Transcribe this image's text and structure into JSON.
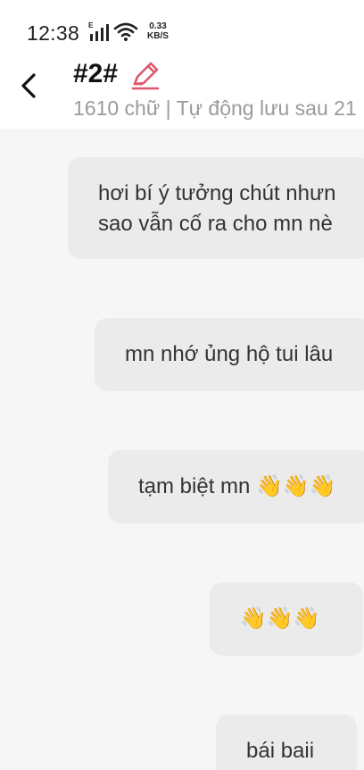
{
  "status_bar": {
    "time": "12:38",
    "network_type": "E",
    "speed_value": "0.33",
    "speed_unit": "KB/S",
    "icons": [
      "signal-icon",
      "wifi-icon"
    ]
  },
  "header": {
    "title": "#2#",
    "meta": "1610 chữ | Tự động lưu sau 21",
    "icons": [
      "back-arrow-icon",
      "pencil-edit-icon"
    ],
    "edit_icon_color": "#e0566b"
  },
  "messages": [
    {
      "lines": [
        "hơi bí ý tưởng chút nhưn",
        "sao vẫn cố ra cho mn nè"
      ]
    },
    {
      "lines": [
        "mn nhớ ủng hộ tui lâu"
      ]
    },
    {
      "lines": [
        "tạm biệt mn 👋👋👋"
      ]
    },
    {
      "lines": [
        "👋👋👋"
      ]
    },
    {
      "lines": [
        "bái baii"
      ]
    }
  ]
}
